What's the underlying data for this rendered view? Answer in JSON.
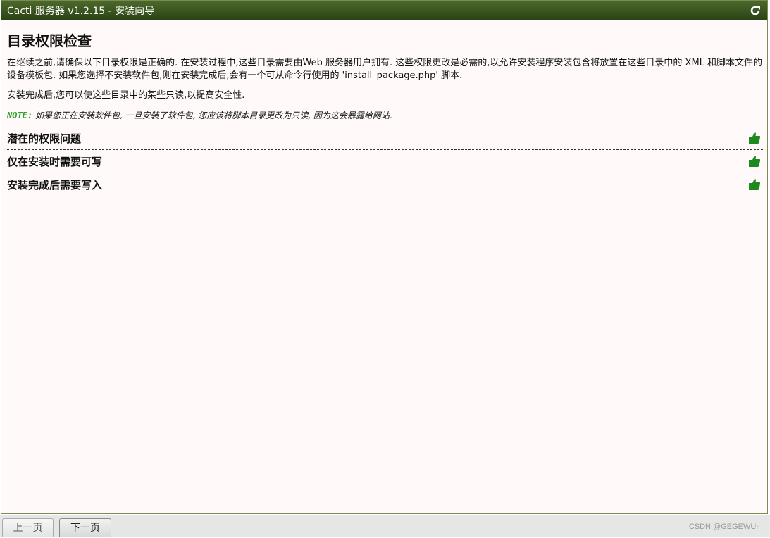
{
  "window": {
    "title": "Cacti 服务器 v1.2.15 - 安装向导",
    "refresh_icon": "refresh-icon"
  },
  "page": {
    "heading": "目录权限检查",
    "paragraph1": "在继续之前,请确保以下目录权限是正确的. 在安装过程中,这些目录需要由Web 服务器用户拥有. 这些权限更改是必需的,以允许安装程序安装包含将放置在这些目录中的 XML 和脚本文件的设备模板包. 如果您选择不安装软件包,则在安装完成后,会有一个可从命令行使用的 'install_package.php' 脚本.",
    "paragraph2": "安装完成后,您可以使这些目录中的某些只读,以提高安全性.",
    "note_label": "NOTE:",
    "note_text": " 如果您正在安装软件包, 一旦安装了软件包, 您应该将脚本目录更改为只读, 因为这会暴露给网站.",
    "checks": [
      {
        "label": "潜在的权限问题",
        "icon": "thumbs-up-icon",
        "status_color": "#1e8a1e"
      },
      {
        "label": "仅在安装时需要可写",
        "icon": "thumbs-up-icon",
        "status_color": "#1e8a1e"
      },
      {
        "label": "安装完成后需要写入",
        "icon": "thumbs-up-icon",
        "status_color": "#1e8a1e"
      }
    ]
  },
  "footer": {
    "prev_label": "上一页",
    "next_label": "下一页",
    "watermark": "CSDN @GEGEWU-"
  },
  "colors": {
    "titlebar": "#3b5620",
    "background": "#fffaf9",
    "note_label": "#2ca02c",
    "ok_icon": "#1e8a1e"
  }
}
